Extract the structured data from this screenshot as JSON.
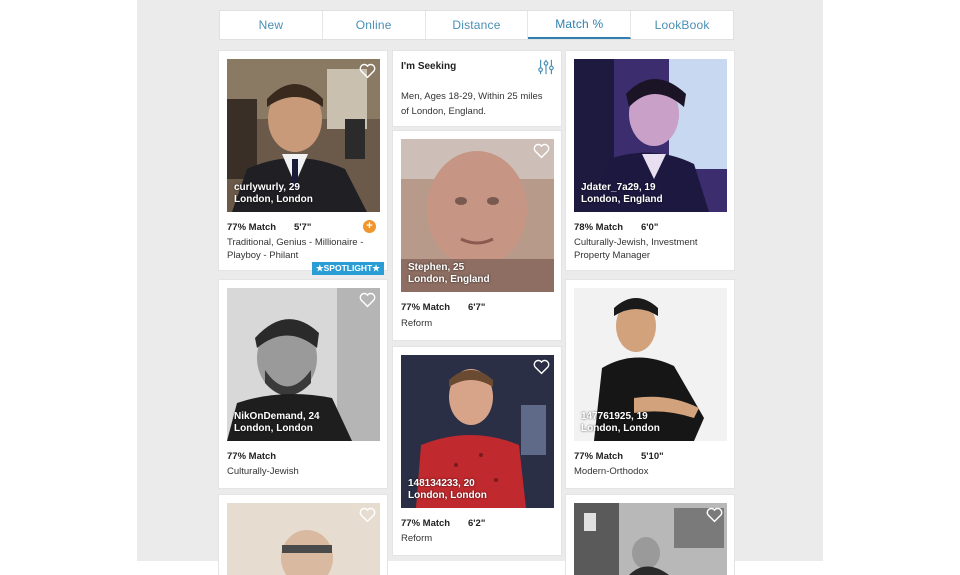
{
  "tabs": [
    {
      "label": "New"
    },
    {
      "label": "Online"
    },
    {
      "label": "Distance"
    },
    {
      "label": "Match %",
      "active": true
    },
    {
      "label": "LookBook"
    }
  ],
  "seeking": {
    "title": "I'm Seeking",
    "text": "Men, Ages 18-29, Within 25 miles of London, England."
  },
  "profiles": {
    "curlywurly": {
      "name": "curlywurly, 29",
      "location": "London, London",
      "match": "77% Match",
      "height": "5'7\"",
      "desc": "Traditional, Genius - Millionaire - Playboy - Philant",
      "badge": "★SPOTLIGHT★"
    },
    "jdater": {
      "name": "Jdater_7a29, 19",
      "location": "London, England",
      "match": "78% Match",
      "height": "6'0\"",
      "desc": "Culturally-Jewish, Investment Property Manager"
    },
    "stephen": {
      "name": "Stephen, 25",
      "location": "London, England",
      "match": "77% Match",
      "height": "6'7\"",
      "desc": "Reform"
    },
    "nikondemand": {
      "name": "NikOnDemand, 24",
      "location": "London, London",
      "match": "77% Match",
      "height": "",
      "desc": "Culturally-Jewish"
    },
    "p147761925": {
      "name": "147761925, 19",
      "location": "London, London",
      "match": "77% Match",
      "height": "5'10\"",
      "desc": "Modern-Orthodox"
    },
    "p148134233": {
      "name": "148134233, 20",
      "location": "London, London",
      "match": "77% Match",
      "height": "6'2\"",
      "desc": "Reform"
    }
  },
  "colors": {
    "accent": "#2f7fb1",
    "spotlight": "#2a9ed4",
    "plus": "#f0962d",
    "background": "#ebebeb"
  },
  "icons": {
    "favorite": "heart-icon",
    "filter": "sliders-icon",
    "add": "plus-icon"
  }
}
